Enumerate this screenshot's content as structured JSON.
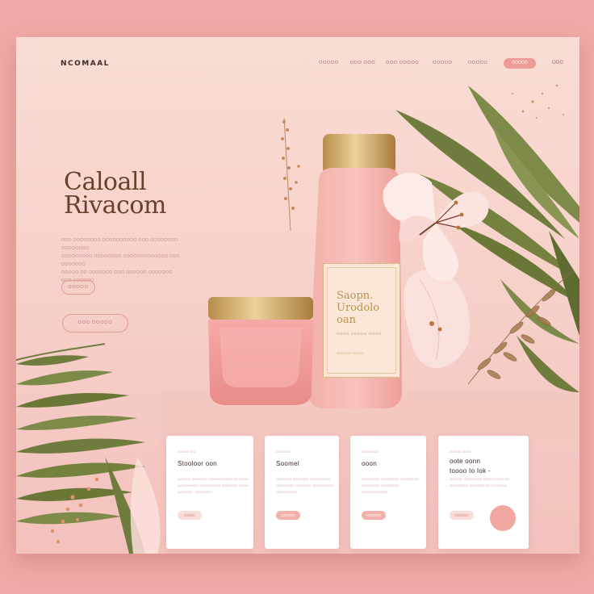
{
  "brand": {
    "logo": "NCOMAAL"
  },
  "nav": {
    "items": [
      "OOOOO",
      "ODO OOO",
      "OOO OOOOO",
      "OOOOO",
      "OOOOO"
    ],
    "cta": "OOOOO",
    "more": "OOO"
  },
  "hero": {
    "title_line1": "Caloall",
    "title_line2": "Rivacom",
    "desc_line1": "OOO OOOOOOOO OOOOOOOOOO OOO OOOOOOOO OOOOOOOO",
    "desc_line2": "OOOOOOOOO OOOOOOOO OOOOOOOOOOOOO OOO OOOOOOO",
    "desc_line3": "OOOOO OO OOOOOOO OOO OOOOOO OOOOOOO",
    "desc_line4": "OOO OOOOOO",
    "button_small": "OOOOO",
    "button_large": "OOO OOOOO"
  },
  "product": {
    "name_line1": "Saopn.",
    "name_line2": "Urodolo",
    "name_line3": "oan",
    "subtitle": "OOOO OOOOO OOOO",
    "detail": "OOOOO OOOO"
  },
  "cards": [
    {
      "kicker": "OOOO OO",
      "title": "Stooloor oon",
      "text": "OOOOO OOOOOO OOOOOOOOO OOOOOO OOOOOOOO OOOOOOOO OOOOOO OOOO OOOOOO OOOOOOO",
      "button": "OOOO"
    },
    {
      "kicker": "OOOOO",
      "title": "Soomel",
      "text": "OOOOOO OOOOOO OOOOOOOO OOOOOOO OOOOOO OOOOOOOO OOOOOOOO",
      "button": "OOOOO"
    },
    {
      "kicker": "OOOOOO",
      "title": "ooon",
      "text": "OOOOOOO OOOOOOO OOOOOOO OOOOOOO OOOOOOO OOOOOOOOOO",
      "button": "OOOOO"
    },
    {
      "kicker": "OOOO OOO",
      "title_line1": "oote oonn",
      "title_line2": "toooo Io Iok -",
      "text": "OOOOO OOOOOOO OOOOOOOOOO OOOOOOO OOOOOOOO OOOOOO",
      "button": "OOOOO"
    }
  ],
  "colors": {
    "background": "#f0a9a6",
    "panel": "#f9ddd4",
    "accent": "#ef9c98",
    "title_brown": "#6b3f2b",
    "gold": "#c9a160",
    "leaf_green": "#6f7c3d"
  }
}
